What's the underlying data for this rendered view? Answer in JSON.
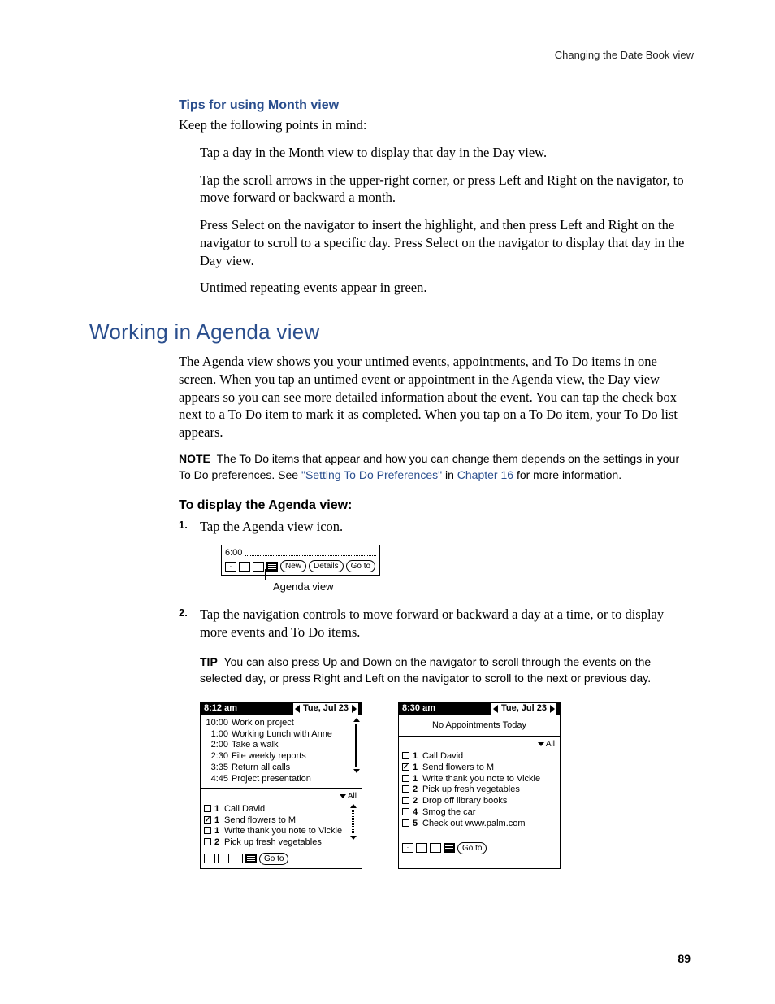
{
  "header": {
    "running": "Changing the Date Book view"
  },
  "sections": {
    "tipsTitle": "Tips for using Month view",
    "tipsIntro": "Keep the following points in mind:",
    "tips": [
      "Tap a day in the Month view to display that day in the Day view.",
      "Tap the scroll arrows in the upper-right corner, or press Left and Right on the navigator, to move forward or backward a month.",
      "Press Select on the navigator to insert the highlight, and then press Left and Right on the navigator to scroll to a specific day. Press Select on the navigator to display that day in the Day view.",
      "Untimed repeating events appear in green."
    ],
    "agendaTitle": "Working in Agenda view",
    "agendaPara": "The Agenda view shows you your untimed events, appointments, and To Do items in one screen. When you tap an untimed event or appointment in the Agenda view, the Day view appears so you can see more detailed information about the event. You can tap the check box next to a To Do item to mark it as completed. When you tap on a To Do item, your To Do list appears.",
    "note": {
      "label": "NOTE",
      "before": "The To Do items that appear and how you can change them depends on the settings in your To Do preferences. See ",
      "link1": "\"Setting To Do Preferences\"",
      "mid": " in ",
      "link2": "Chapter 16",
      "after": " for more information."
    },
    "displayTitle": "To display the Agenda view:",
    "steps": [
      "Tap the Agenda view icon.",
      "Tap the navigation controls to move forward or backward a day at a time, or to display more events and To Do items."
    ],
    "tip": {
      "label": "TIP",
      "text": "You can also press Up and Down on the navigator to scroll through the events on the selected day, or press Right and Left on the navigator to scroll to the next or previous day."
    }
  },
  "figToolbar": {
    "time": "6:00",
    "buttons": [
      "New",
      "Details",
      "Go to"
    ],
    "caption": "Agenda view"
  },
  "screenA": {
    "time": "8:12 am",
    "date": "Tue, Jul 23",
    "events": [
      {
        "t": "10:00",
        "d": "Work on project"
      },
      {
        "t": "1:00",
        "d": "Working Lunch with Anne"
      },
      {
        "t": "2:00",
        "d": "Take a walk"
      },
      {
        "t": "2:30",
        "d": "File weekly reports"
      },
      {
        "t": "3:35",
        "d": "Return all calls"
      },
      {
        "t": "4:45",
        "d": "Project presentation"
      }
    ],
    "allLabel": "All",
    "todos": [
      {
        "c": false,
        "p": "1",
        "d": "Call David"
      },
      {
        "c": true,
        "p": "1",
        "d": "Send flowers to M"
      },
      {
        "c": false,
        "p": "1",
        "d": "Write thank you note to Vickie"
      },
      {
        "c": false,
        "p": "2",
        "d": "Pick up fresh vegetables"
      }
    ],
    "goto": "Go to"
  },
  "screenB": {
    "time": "8:30 am",
    "date": "Tue, Jul 23",
    "noAppt": "No Appointments Today",
    "allLabel": "All",
    "todos": [
      {
        "c": false,
        "p": "1",
        "d": "Call David"
      },
      {
        "c": true,
        "p": "1",
        "d": "Send flowers to M"
      },
      {
        "c": false,
        "p": "1",
        "d": "Write thank you note to Vickie"
      },
      {
        "c": false,
        "p": "2",
        "d": "Pick up fresh vegetables"
      },
      {
        "c": false,
        "p": "2",
        "d": "Drop off library books"
      },
      {
        "c": false,
        "p": "4",
        "d": "Smog the car"
      },
      {
        "c": false,
        "p": "5",
        "d": "Check out www.palm.com"
      }
    ],
    "goto": "Go to"
  },
  "pageNumber": "89"
}
